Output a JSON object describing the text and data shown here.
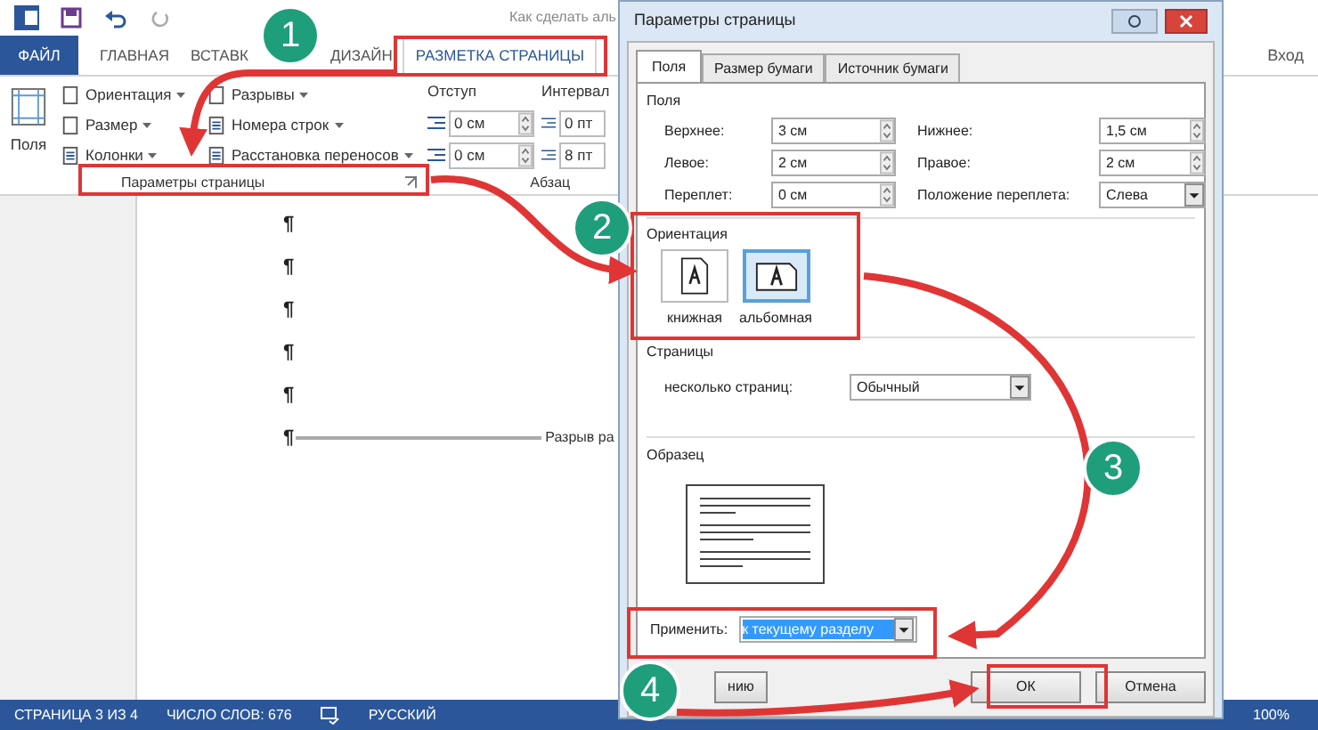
{
  "word": {
    "title": "Как сделать аль",
    "sign_in": "Вход",
    "tabs": [
      {
        "label": "ФАЙЛ",
        "kind": "file",
        "selected": false
      },
      {
        "label": "ГЛАВНАЯ",
        "kind": "tab",
        "selected": false
      },
      {
        "label": "ВСТАВК",
        "kind": "tab",
        "selected": false
      },
      {
        "label": "ДИЗАЙН",
        "kind": "tab",
        "selected": false
      },
      {
        "label": "РАЗМЕТКА СТРАНИЦЫ",
        "kind": "tab",
        "selected": true
      }
    ]
  },
  "ribbon": {
    "big_button": "Поля",
    "commands": [
      {
        "label": "Ориентация"
      },
      {
        "label": "Размер"
      },
      {
        "label": "Колонки"
      },
      {
        "label": "Разрывы"
      },
      {
        "label": "Номера строк"
      },
      {
        "label": "Расстановка переносов"
      }
    ],
    "page_setup_group": "Параметры страницы",
    "indent": {
      "label": "Отступ",
      "values": [
        "0 см",
        "0 см"
      ]
    },
    "spacing": {
      "label": "Интервал",
      "values": [
        "0 пт",
        "8 пт"
      ]
    },
    "paragraph_group": "Абзац"
  },
  "document": {
    "marks": [
      "¶",
      "¶",
      "¶",
      "¶",
      "¶",
      "¶"
    ],
    "break_label": "Разрыв ра"
  },
  "status_bar": {
    "page": "СТРАНИЦА 3 ИЗ 4",
    "words": "ЧИСЛО СЛОВ: 676",
    "language": "РУССКИЙ",
    "zoom": "100%"
  },
  "dialog": {
    "title": "Параметры страницы",
    "tabs": [
      {
        "label": "Поля",
        "selected": true
      },
      {
        "label": "Размер бумаги",
        "selected": false
      },
      {
        "label": "Источник бумаги",
        "selected": false
      }
    ],
    "margins_heading": "Поля",
    "fields": [
      {
        "label": "Верхнее:",
        "value": "3 см",
        "kind": "spin"
      },
      {
        "label": "Нижнее:",
        "value": "1,5 см",
        "kind": "spin"
      },
      {
        "label": "Левое:",
        "value": "2 см",
        "kind": "spin"
      },
      {
        "label": "Правое:",
        "value": "2 см",
        "kind": "spin"
      },
      {
        "label": "Переплет:",
        "value": "0 см",
        "kind": "spin"
      },
      {
        "label": "Положение переплета:",
        "value": "Слева",
        "kind": "select"
      }
    ],
    "orientation_heading": "Ориентация",
    "orientations": [
      {
        "label": "книжная",
        "kind": "portrait",
        "selected": false
      },
      {
        "label": "альбомная",
        "kind": "landscape",
        "selected": true
      }
    ],
    "pages_heading": "Страницы",
    "pages_label": "несколько страниц:",
    "pages_value": "Обычный",
    "preview_heading": "Образец",
    "apply_label": "Применить:",
    "apply_value": "к текущему разделу",
    "buttons": [
      "нию",
      "ОК",
      "Отмена"
    ]
  },
  "steps": [
    "1",
    "2",
    "3",
    "4"
  ]
}
